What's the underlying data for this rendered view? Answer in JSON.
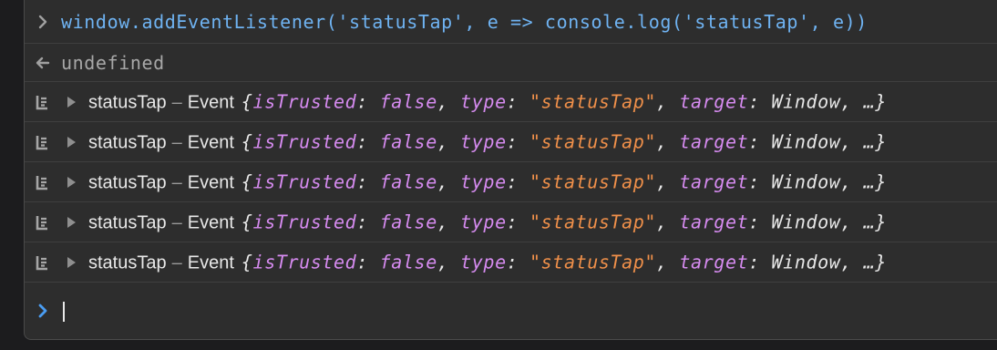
{
  "command": {
    "text": "window.addEventListener('statusTap', e => console.log('statusTap', e))"
  },
  "result": {
    "text": "undefined"
  },
  "log_entries": [
    {
      "name": "statusTap",
      "separator": "–",
      "type": "Event",
      "open": "{",
      "k1": "isTrusted",
      "v1": "false",
      "k2": "type",
      "v2": "\"statusTap\"",
      "k3": "target",
      "v3": "Window",
      "tail": "…}"
    },
    {
      "name": "statusTap",
      "separator": "–",
      "type": "Event",
      "open": "{",
      "k1": "isTrusted",
      "v1": "false",
      "k2": "type",
      "v2": "\"statusTap\"",
      "k3": "target",
      "v3": "Window",
      "tail": "…}"
    },
    {
      "name": "statusTap",
      "separator": "–",
      "type": "Event",
      "open": "{",
      "k1": "isTrusted",
      "v1": "false",
      "k2": "type",
      "v2": "\"statusTap\"",
      "k3": "target",
      "v3": "Window",
      "tail": "…}"
    },
    {
      "name": "statusTap",
      "separator": "–",
      "type": "Event",
      "open": "{",
      "k1": "isTrusted",
      "v1": "false",
      "k2": "type",
      "v2": "\"statusTap\"",
      "k3": "target",
      "v3": "Window",
      "tail": "…}"
    },
    {
      "name": "statusTap",
      "separator": "–",
      "type": "Event",
      "open": "{",
      "k1": "isTrusted",
      "v1": "false",
      "k2": "type",
      "v2": "\"statusTap\"",
      "k3": "target",
      "v3": "Window",
      "tail": "…}"
    }
  ],
  "prompt": {
    "value": ""
  },
  "icons": {
    "command": "chevron-right-icon",
    "result": "return-arrow-icon",
    "log": "console-log-icon",
    "disclosure": "disclosure-triangle-icon",
    "prompt": "prompt-chevron-icon"
  },
  "colors": {
    "background": "#2d2d2d",
    "command_text": "#6fb3f2",
    "property_key": "#d68bf0",
    "string_value": "#f0904a",
    "prompt_chevron": "#4a9df2"
  }
}
